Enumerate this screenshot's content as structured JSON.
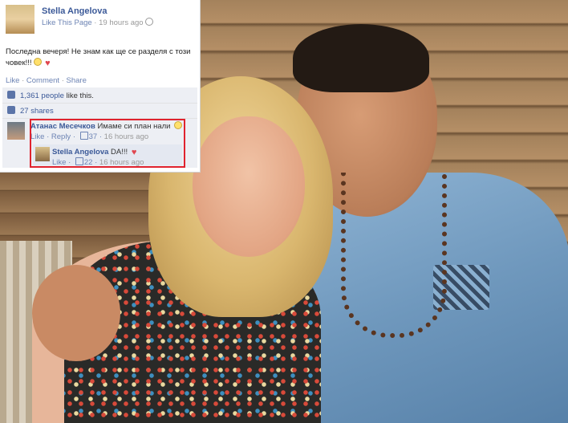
{
  "post": {
    "page_name": "Stella Angelova",
    "like_page": "Like This Page",
    "separator": " · ",
    "time": "19 hours ago",
    "text": "Последна вечеря! Не знам как ще се разделя с този човек!!!",
    "actions": {
      "like": "Like",
      "comment": "Comment",
      "share": "Share",
      "dot": " · "
    }
  },
  "ufi": {
    "likes_count": "1,361 people",
    "likes_suffix": " like this.",
    "shares": "27 shares"
  },
  "comments": [
    {
      "author": "Атанас Месечков",
      "text": "Имаме си план нали",
      "like": "Like",
      "reply": "Reply",
      "likes": "37",
      "time": "16 hours ago"
    },
    {
      "author": "Stella Angelova",
      "text": "DA!!!",
      "like": "Like",
      "likes": "22",
      "time": "16 hours ago"
    }
  ],
  "colors": {
    "link": "#3b5998",
    "highlight": "#e0232e",
    "heart": "#e0464f"
  },
  "icons": [
    "globe-icon",
    "smiley-icon",
    "heart-icon",
    "thumbs-up-icon",
    "share-icon"
  ]
}
